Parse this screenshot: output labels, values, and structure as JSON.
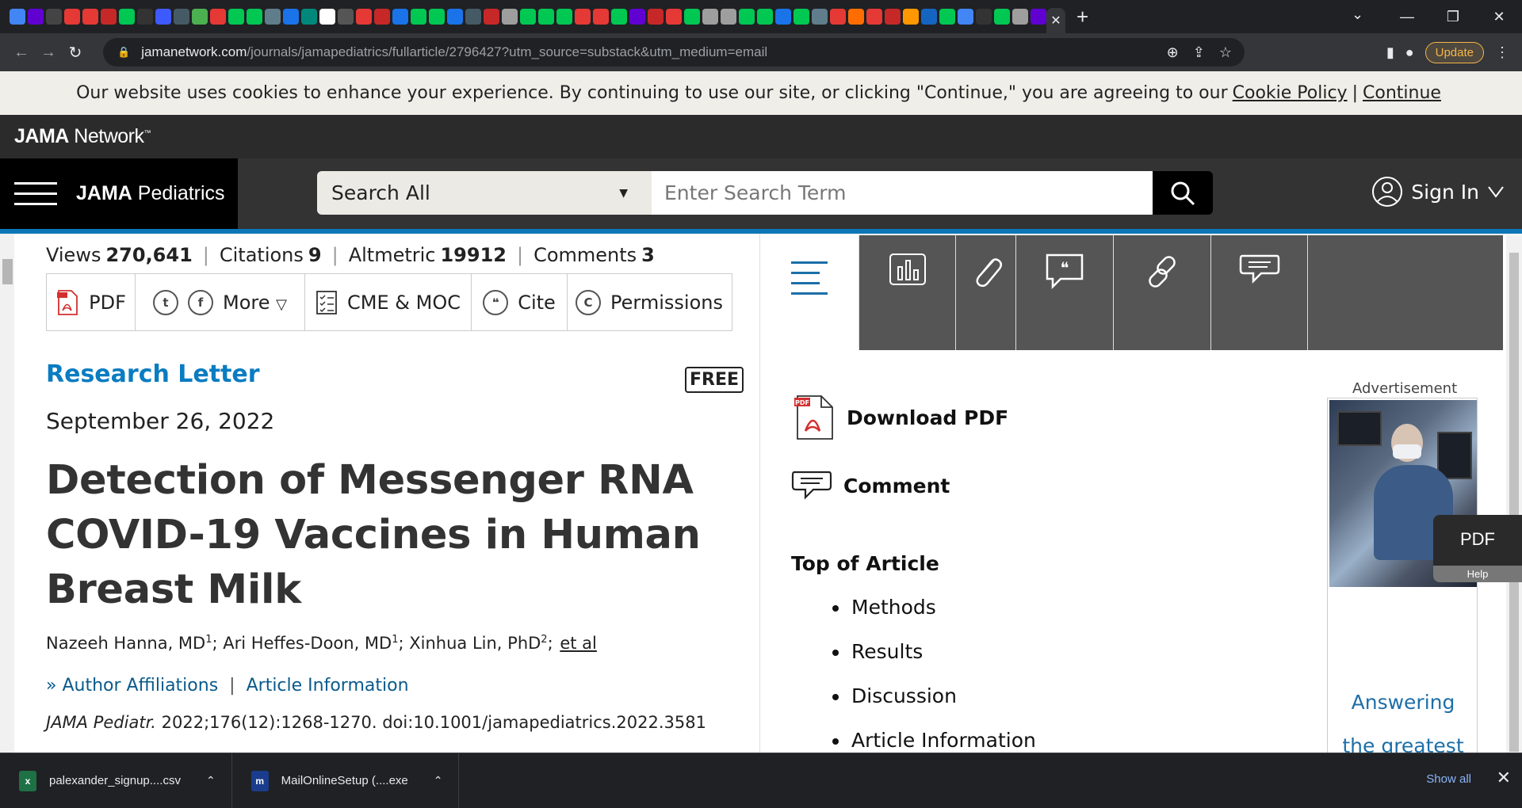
{
  "browser": {
    "favicons": [
      "#4285f4",
      "#6001d2",
      "#444",
      "#e53935",
      "#e53935",
      "#c62828",
      "#00c853",
      "#333",
      "#3d5afe",
      "#455a64",
      "#4caf50",
      "#e53935",
      "#00c853",
      "#00c853",
      "#607d8b",
      "#1a73e8",
      "#00897b",
      "#ffffff",
      "#555",
      "#e53935",
      "#c62828",
      "#1a73e8",
      "#00c853",
      "#00c853",
      "#1a73e8",
      "#455a64",
      "#c62828",
      "#9e9e9e",
      "#00c853",
      "#00c853",
      "#00c853",
      "#e53935",
      "#e53935",
      "#00c853",
      "#6001d2",
      "#c62828",
      "#e53935",
      "#00c853",
      "#9e9e9e",
      "#9e9e9e",
      "#00c853",
      "#00c853",
      "#1a73e8",
      "#00c853",
      "#607d8b",
      "#e53935",
      "#ff6d00",
      "#e53935",
      "#c62828",
      "#ff9800",
      "#1565c0",
      "#00c853",
      "#4285f4",
      "#333",
      "#00c853",
      "#9e9e9e",
      "#6001d2"
    ],
    "active_tab_close": "✕",
    "new_tab": "+",
    "tab_list_icon": "⌄",
    "window_controls": [
      "—",
      "❐",
      "✕"
    ],
    "url_host": "jamanetwork.com",
    "url_path": "/journals/jamapediatrics/fullarticle/2796427?utm_source=substack&utm_medium=email",
    "update_label": "Update"
  },
  "cookie_banner": {
    "text": "Our website uses cookies to enhance your experience. By continuing to use our site, or clicking \"Continue,\" you are agreeing to our",
    "policy_link": "Cookie Policy",
    "separator": "|",
    "continue_link": "Continue"
  },
  "network": {
    "logo_bold": "JAMA",
    "logo_rest": " Network",
    "logo_tm": "™"
  },
  "journal": {
    "name_bold": "JAMA",
    "name_rest": " Pediatrics",
    "search_scope": "Search All",
    "search_placeholder": "Enter Search Term",
    "sign_in": "Sign In"
  },
  "metrics": {
    "views_label": "Views",
    "views_value": "270,641",
    "citations_label": "Citations",
    "citations_value": "9",
    "altmetric_label": "Altmetric",
    "altmetric_value": "19912",
    "comments_label": "Comments",
    "comments_value": "3"
  },
  "actions": {
    "pdf": "PDF",
    "more": "More",
    "cme": "CME & MOC",
    "cite": "Cite",
    "permissions": "Permissions"
  },
  "article": {
    "type": "Research Letter",
    "free_badge": "FREE",
    "date": "September 26, 2022",
    "title": "Detection of Messenger RNA COVID-19 Vaccines in Human Breast Milk",
    "authors": [
      {
        "name": "Nazeeh Hanna, MD",
        "aff": "1"
      },
      {
        "name": "Ari Heffes-Doon, MD",
        "aff": "1"
      },
      {
        "name": "Xinhua Lin, PhD",
        "aff": "2"
      }
    ],
    "et_al": "et al",
    "author_affiliations": "Author Affiliations",
    "article_information": "Article Information",
    "citation_journal": "JAMA Pediatr.",
    "citation_rest": " 2022;176(12):1268-1270. doi:10.1001/jamapediatrics.2022.3581"
  },
  "sidebar": {
    "download_pdf": "Download PDF",
    "comment": "Comment",
    "toc_heading": "Top of Article",
    "toc_items": [
      "Methods",
      "Results",
      "Discussion",
      "Article Information"
    ],
    "ad_label": "Advertisement",
    "ad_text_line1": "Answering",
    "ad_text_line2": "the greatest",
    "pdf_float": "PDF",
    "help": "Help"
  },
  "downloads": {
    "items": [
      {
        "name": "palexander_signup....csv",
        "icon": "x",
        "color": "#1e7145"
      },
      {
        "name": "MailOnlineSetup (....exe",
        "icon": "m",
        "color": "#1a3c8c"
      }
    ],
    "show_all": "Show all"
  }
}
